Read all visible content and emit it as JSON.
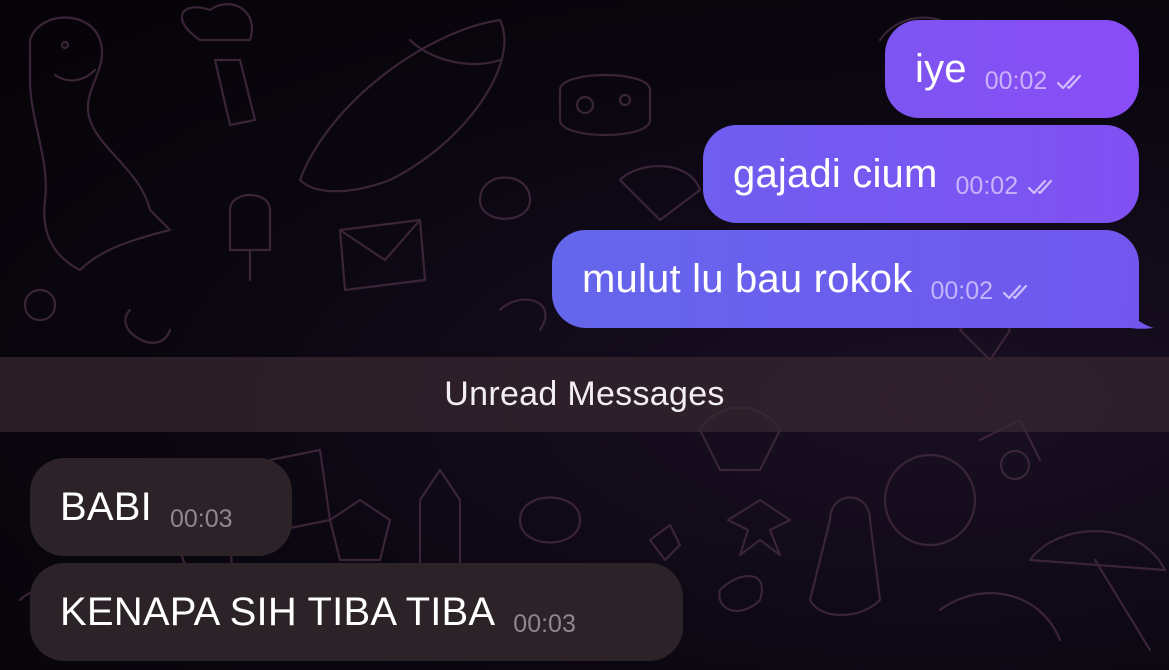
{
  "messages_outgoing": [
    {
      "text": "iye",
      "time": "00:02",
      "status_icon": "double-check-icon"
    },
    {
      "text": "gajadi cium",
      "time": "00:02",
      "status_icon": "double-check-icon"
    },
    {
      "text": "mulut lu bau rokok",
      "time": "00:02",
      "status_icon": "double-check-icon"
    }
  ],
  "unread_divider": {
    "label": "Unread Messages"
  },
  "messages_incoming": [
    {
      "text": "BABI",
      "time": "00:03"
    },
    {
      "text": "KENAPA SIH TIBA TIBA",
      "time": "00:03"
    }
  ],
  "colors": {
    "outgoing_bubble": "#7d55f0",
    "incoming_bubble": "#2b2328",
    "background": "#0b0710",
    "divider": "#372830"
  }
}
